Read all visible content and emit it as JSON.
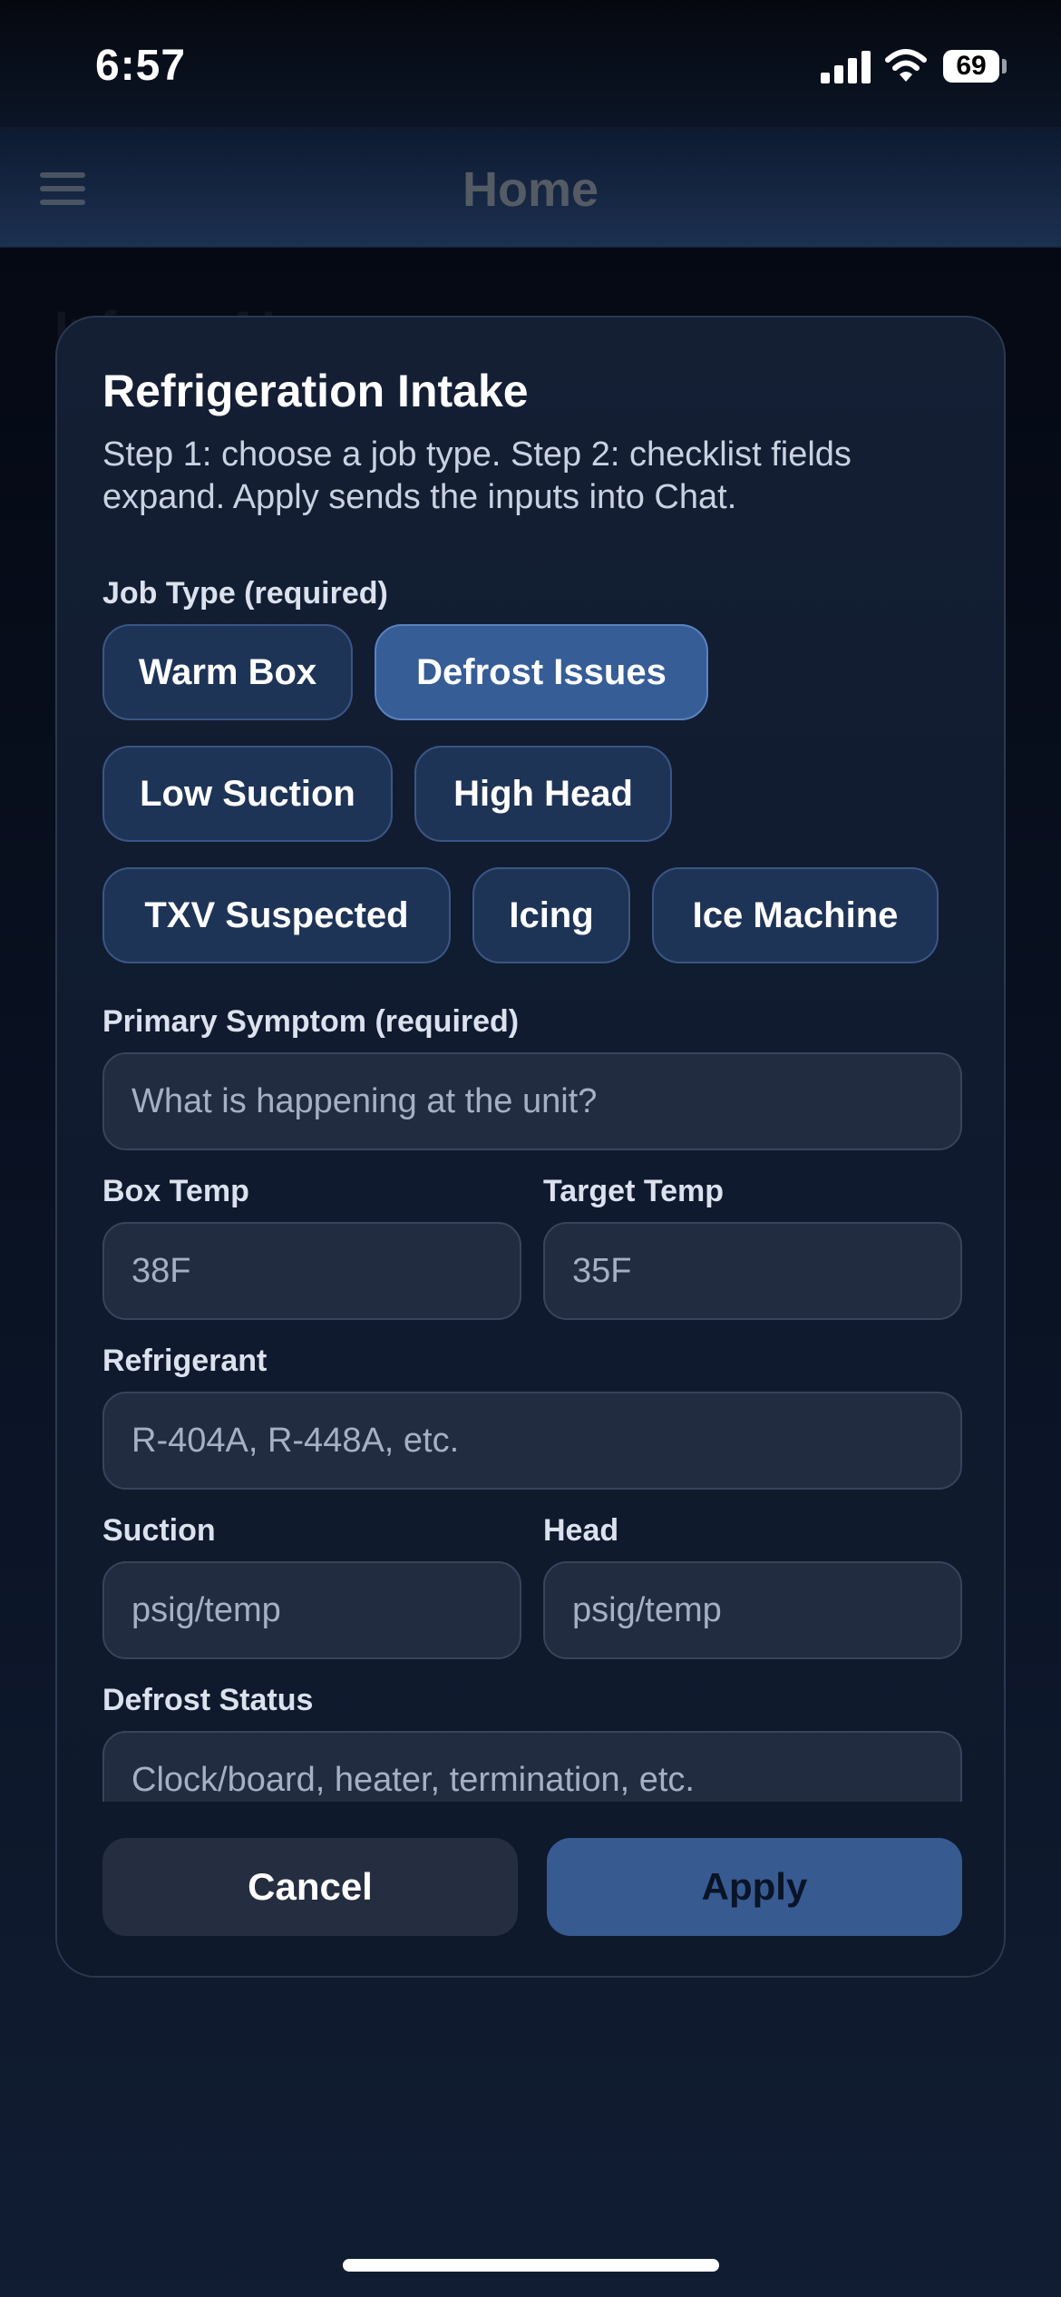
{
  "status_bar": {
    "time": "6:57",
    "battery": "69"
  },
  "header": {
    "title": "Home"
  },
  "background": {
    "heading": "Inform AI pro"
  },
  "modal": {
    "title": "Refrigeration Intake",
    "description": "Step 1: choose a job type. Step 2: checklist fields expand. Apply sends the inputs into Chat.",
    "job_type_label": "Job Type (required)",
    "job_types": [
      {
        "label": "Warm Box",
        "selected": false
      },
      {
        "label": "Defrost Issues",
        "selected": true
      },
      {
        "label": "Low Suction",
        "selected": false
      },
      {
        "label": "High Head",
        "selected": false
      },
      {
        "label": "TXV Suspected",
        "selected": false
      },
      {
        "label": "Icing",
        "selected": false
      },
      {
        "label": "Ice Machine",
        "selected": false
      }
    ],
    "fields": {
      "primary_symptom": {
        "label": "Primary Symptom (required)",
        "placeholder": "What is happening at the unit?"
      },
      "box_temp": {
        "label": "Box Temp",
        "placeholder": "38F"
      },
      "target_temp": {
        "label": "Target Temp",
        "placeholder": "35F"
      },
      "refrigerant": {
        "label": "Refrigerant",
        "placeholder": "R-404A, R-448A, etc."
      },
      "suction": {
        "label": "Suction",
        "placeholder": "psig/temp"
      },
      "head": {
        "label": "Head",
        "placeholder": "psig/temp"
      },
      "defrost_status": {
        "label": "Defrost Status",
        "placeholder": "Clock/board, heater, termination, etc."
      }
    },
    "buttons": {
      "cancel": "Cancel",
      "apply": "Apply"
    }
  },
  "colors": {
    "chip": "#1e3457",
    "chip_selected": "#365d96",
    "apply_button": "#375a91",
    "modal_background": "#111c30"
  }
}
